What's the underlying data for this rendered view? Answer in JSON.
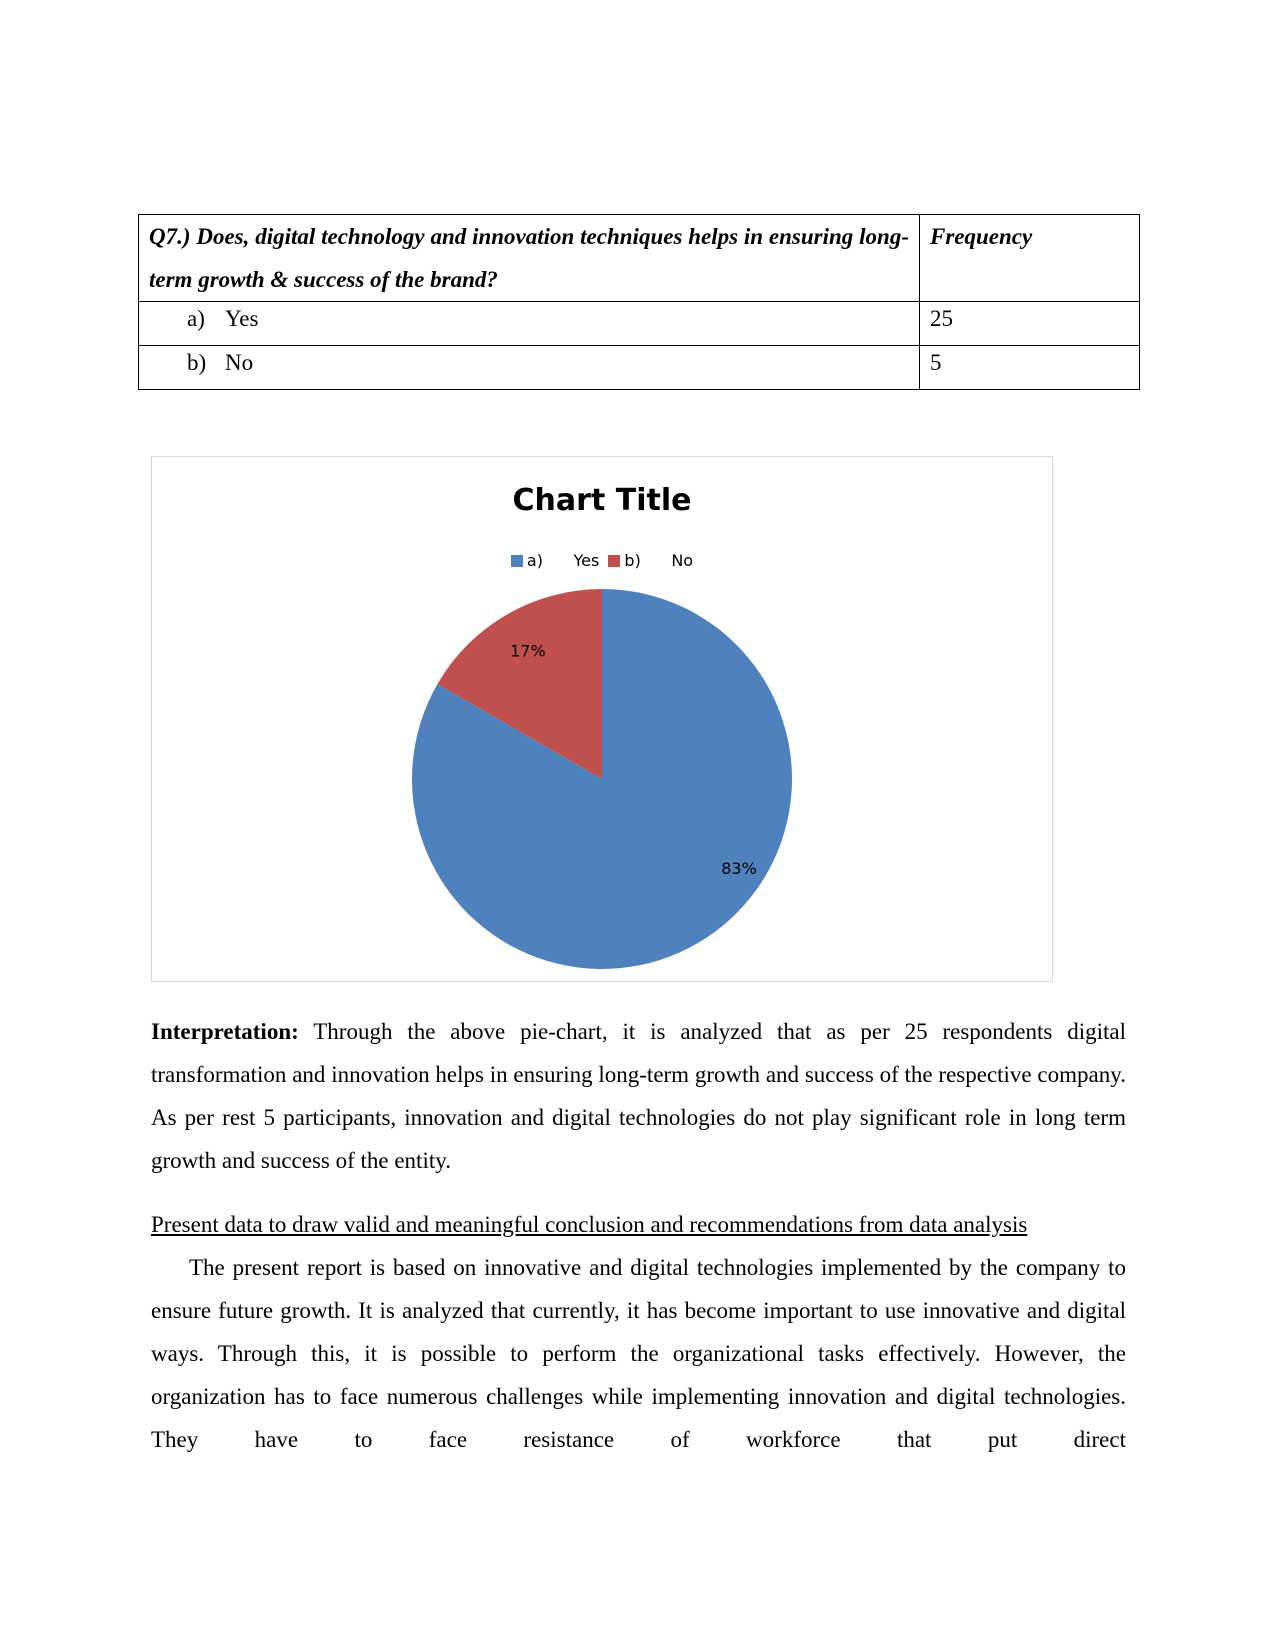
{
  "table": {
    "question": "Q7.) Does, digital technology and innovation techniques helps in ensuring long-term growth & success of the brand?",
    "frequency_header": "Frequency",
    "rows": [
      {
        "letter": "a)",
        "option": "Yes",
        "frequency": "25"
      },
      {
        "letter": "b)",
        "option": "No",
        "frequency": "5"
      }
    ]
  },
  "chart_data": {
    "type": "pie",
    "title": "Chart Title",
    "categories": [
      "a)      Yes",
      "b)      No"
    ],
    "values": [
      25,
      5
    ],
    "percent_labels": [
      "83%",
      "17%"
    ],
    "colors": [
      "#4f81bd",
      "#c0504d"
    ],
    "legend_position": "top",
    "start_angle": "12 o'clock",
    "direction": "clockwise"
  },
  "text": {
    "interpretation_label": "Interpretation:",
    "interpretation_body": " Through the above pie-chart, it is analyzed that as per 25 respondents digital transformation and innovation helps in ensuring long-term growth and success of the respective company. As per rest 5 participants, innovation and digital technologies do not play significant role in long term growth and success of the entity.",
    "section_heading": "Present data to draw valid and meaningful conclusion and recommendations from data analysis",
    "body_paragraph": "The present report is based on innovative and digital technologies implemented by the company to ensure future growth. It is analyzed that currently, it has become important to use innovative and digital ways. Through this, it is possible to perform the organizational tasks effectively. However, the organization has to face numerous challenges while implementing innovation and digital technologies. They have to face resistance of workforce that put direct"
  }
}
